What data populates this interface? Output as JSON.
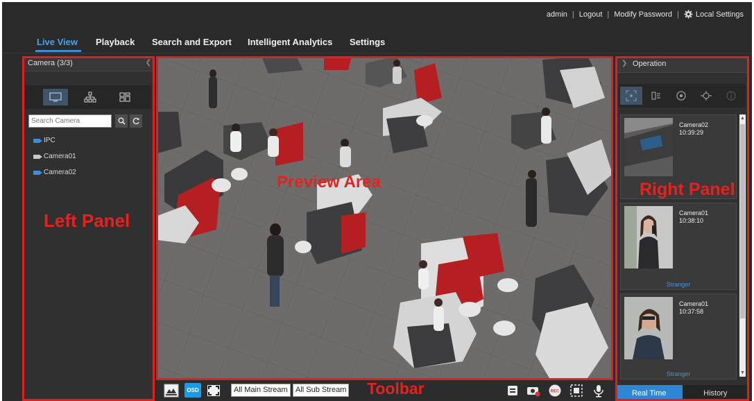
{
  "topbar": {
    "user": "admin",
    "logout": "Logout",
    "modify_password": "Modify Password",
    "local_settings": "Local Settings"
  },
  "nav": {
    "tabs": [
      "Live View",
      "Playback",
      "Search and Export",
      "Intelligent Analytics",
      "Settings"
    ],
    "active": "Live View"
  },
  "left_panel": {
    "title": "Camera (3/3)",
    "search_placeholder": "Search Camera",
    "tree": [
      {
        "label": "IPC",
        "icon": "camera-group-icon"
      },
      {
        "label": "Camera01",
        "icon": "camera-icon"
      },
      {
        "label": "Camera02",
        "icon": "camera-icon"
      }
    ]
  },
  "toolbar": {
    "osd_label": "OSD",
    "main_stream": "All Main Stream",
    "sub_stream": "All Sub Stream"
  },
  "right_panel": {
    "title": "Operation",
    "cards": [
      {
        "camera": "Camera02",
        "time": "10:39:29",
        "footer": ""
      },
      {
        "camera": "Camera01",
        "time": "10:38:10",
        "footer": "Stranger"
      },
      {
        "camera": "Camera01",
        "time": "10:37:58",
        "footer": "Stranger"
      }
    ],
    "bottom_tabs": [
      "Real Time",
      "History"
    ],
    "active_bottom": "Real Time"
  },
  "annotations": {
    "left_panel": "Left Panel",
    "preview_area": "Preview Area",
    "right_panel": "Right Panel",
    "toolbar": "Toolbar"
  },
  "colors": {
    "accent": "#3a8fd8",
    "annotation_red": "#e02020",
    "background": "#2b2b2b"
  }
}
